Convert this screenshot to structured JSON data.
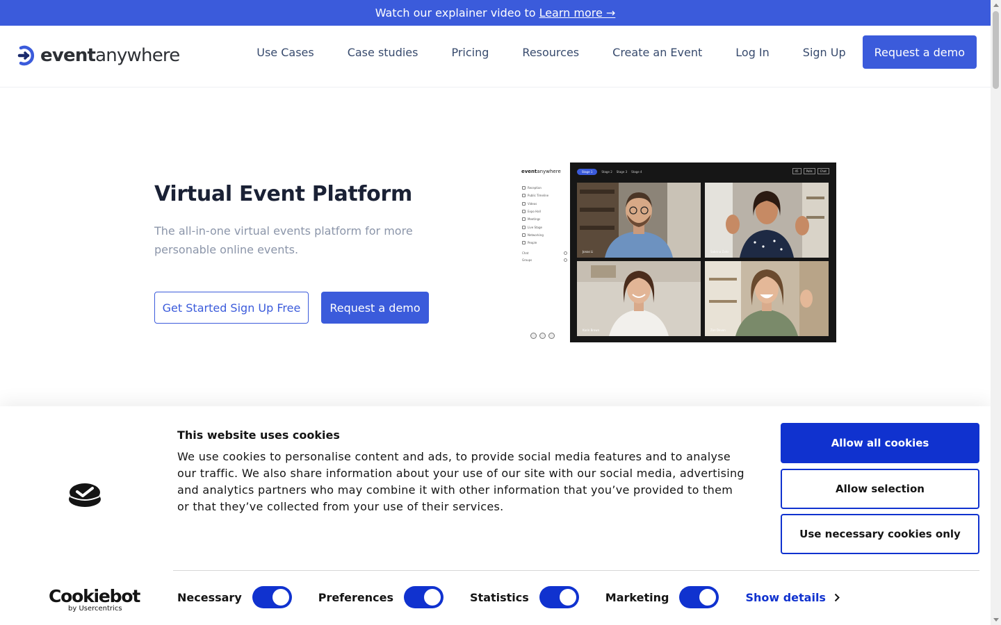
{
  "announcement": {
    "text": "Watch our explainer video to",
    "link": "Learn more →"
  },
  "header": {
    "logo": {
      "bold": "event",
      "light": "anywhere"
    },
    "nav": [
      "Use Cases",
      "Case studies",
      "Pricing",
      "Resources",
      "Create an Event",
      "Log In",
      "Sign Up"
    ],
    "cta": "Request a demo"
  },
  "hero": {
    "title": "Virtual Event Platform",
    "subtitle": "The all-in-one virtual events platform for more personable online events.",
    "primary_button": "Get Started Sign Up Free",
    "secondary_button": "Request a demo"
  },
  "mockup": {
    "logo": {
      "bold": "event",
      "light": "anywhere"
    },
    "menu": [
      "Reception",
      "Public Timeline",
      "Videos",
      "Expo Hall",
      "Meetings",
      "Live Stage",
      "Networking",
      "People"
    ],
    "chat": [
      "Chat",
      "Groups"
    ],
    "tabs": [
      "Stage 1",
      "Stage 2",
      "Stage 3",
      "Stage 4"
    ],
    "tools": [
      "45",
      "Polls",
      "Chat"
    ],
    "tiles": [
      "Jonas Li",
      "Sabrina Zahir",
      "Karin Brown",
      "Zoe Devon"
    ]
  },
  "cookie": {
    "title": "This website uses cookies",
    "body": "We use cookies to personalise content and ads, to provide social media features and to analyse our traffic. We also share information about your use of our site with our social media, advertising and analytics partners who may combine it with other information that you’ve provided to them or that they’ve collected from your use of their services.",
    "allow_all": "Allow all cookies",
    "allow_selection": "Allow selection",
    "necessary_only": "Use necessary cookies only",
    "toggles": [
      {
        "label": "Necessary",
        "on": true
      },
      {
        "label": "Preferences",
        "on": true
      },
      {
        "label": "Statistics",
        "on": true
      },
      {
        "label": "Marketing",
        "on": true
      }
    ],
    "show_details": "Show details",
    "brand": {
      "title": "Cookiebot",
      "sub": "by Usercentrics"
    }
  },
  "colors": {
    "brand_blue": "#3b5bdb",
    "cookiebot_blue": "#1032cf",
    "text_dark": "#1a2135",
    "text_muted": "#8b95a9"
  }
}
